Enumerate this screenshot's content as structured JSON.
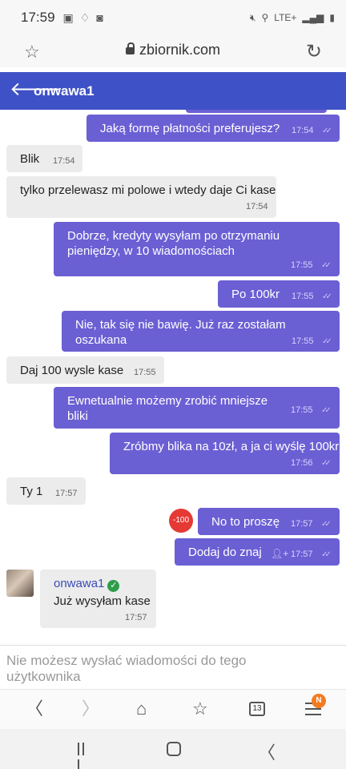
{
  "status_bar": {
    "time": "17:59",
    "network": "LTE+"
  },
  "browser": {
    "url": "zbiornik.com",
    "tab_count": "13",
    "menu_badge": "N"
  },
  "header": {
    "title": "onwawa1",
    "color": "#3f51c6"
  },
  "messages": [
    {
      "dir": "out",
      "text": "Jaką formę płatności preferujesz?",
      "time": "17:54"
    },
    {
      "dir": "in",
      "text": "Blik",
      "time": "17:54"
    },
    {
      "dir": "in",
      "text": "tylko przelewasz mi polowe i wtedy daje Ci kase",
      "time": "17:54"
    },
    {
      "dir": "out",
      "text": "Dobrze, kredyty wysyłam po otrzymaniu pieniędzy, w 10 wiadomościach",
      "time": "17:55"
    },
    {
      "dir": "out",
      "text": "Po 100kr",
      "time": "17:55"
    },
    {
      "dir": "out",
      "text": "Nie, tak się nie bawię. Już raz zostałam oszukana",
      "time": "17:55"
    },
    {
      "dir": "in",
      "text": "Daj 100 wysle kase",
      "time": "17:55"
    },
    {
      "dir": "out",
      "text": "Ewnetualnie możemy zrobić mniejsze bliki",
      "time": "17:55"
    },
    {
      "dir": "out",
      "text": "Zróbmy blika na 10zł, a ja ci wyślę 100kr",
      "time": "17:56"
    },
    {
      "dir": "in",
      "text": "Ty 1",
      "time": "17:57"
    },
    {
      "dir": "out",
      "text": "No to proszę",
      "time": "17:57",
      "badge": "-100"
    },
    {
      "dir": "out",
      "text": "Dodaj do znaj",
      "time": "17:57",
      "icon": "add-user-icon"
    },
    {
      "dir": "in",
      "sender": "onwawa1",
      "verified": true,
      "text": "Już wysyłam kase",
      "time": "17:57"
    }
  ],
  "input": {
    "notice": "Nie możesz wysłać wiadomości do tego użytkownika"
  },
  "colors": {
    "outgoing_bubble": "#6b5fd4",
    "incoming_bubble": "#ececec",
    "badge_red": "#e53935",
    "verified_green": "#2e9d4a",
    "menu_badge_orange": "#f47b20"
  }
}
